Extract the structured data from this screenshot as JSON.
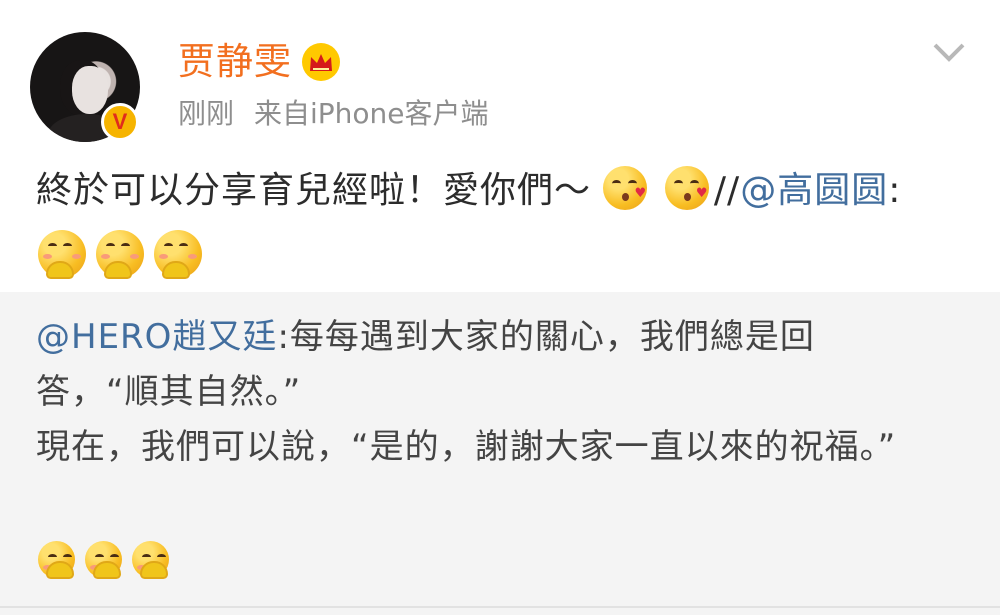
{
  "header": {
    "username": "贾静雯",
    "time": "刚刚",
    "source": "来自iPhone客户端",
    "icons": {
      "avatar": "profile-photo",
      "verified": "verified-badge-icon",
      "crown": "crown-icon",
      "menu": "chevron-down-icon"
    }
  },
  "post": {
    "text": "終於可以分享育兒經啦！愛你們～",
    "separator": "//",
    "mention": "@高圆圆",
    "colon": ":",
    "emoji_names": [
      "kissing-heart-emoji",
      "kissing-heart-emoji",
      "blushing-hand-emoji",
      "blushing-hand-emoji",
      "blushing-hand-emoji"
    ]
  },
  "repost": {
    "mention": "@HERO趙又廷",
    "line_one_text": ":每每遇到大家的關心，我們總是回答，“順其自然。”",
    "line_two_text": "現在，我們可以說，“是的，謝謝大家一直以來的祝福。”",
    "emoji_names": [
      "blushing-hand-emoji",
      "blushing-hand-emoji",
      "blushing-hand-emoji"
    ]
  },
  "colors": {
    "username": "#f26f1f",
    "mention": "#426e9e",
    "meta": "#8e8e8e",
    "repost_background": "#f4f4f4"
  }
}
